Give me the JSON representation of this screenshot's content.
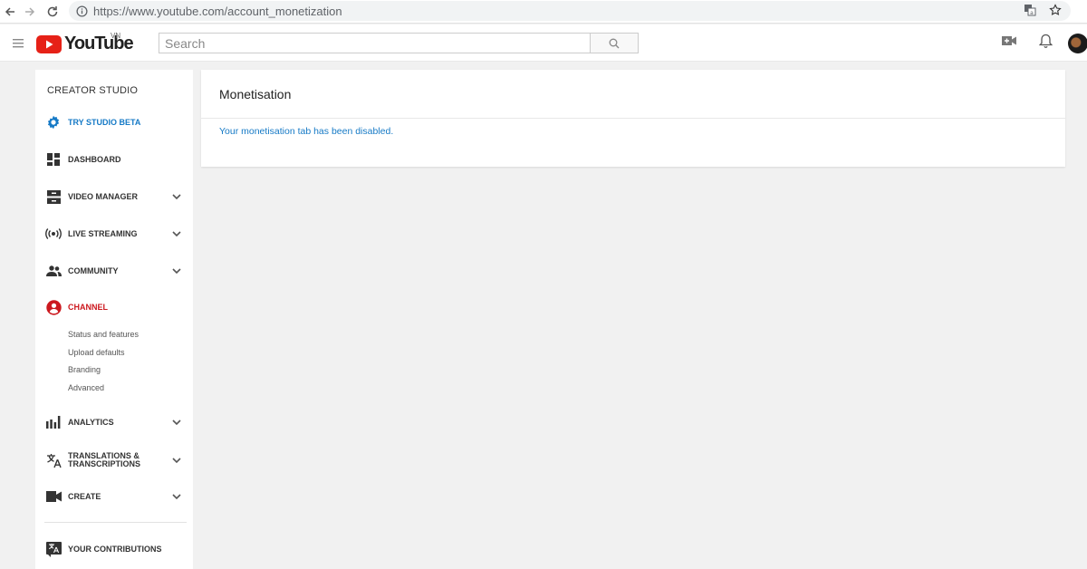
{
  "browser": {
    "url": "https://www.youtube.com/account_monetization"
  },
  "header": {
    "logo_word": "YouTube",
    "country_code": "VN",
    "search_placeholder": "Search"
  },
  "sidebar": {
    "title": "CREATOR STUDIO",
    "items": [
      {
        "label": "TRY STUDIO BETA",
        "icon": "gear-icon"
      },
      {
        "label": "DASHBOARD",
        "icon": "dashboard-icon"
      },
      {
        "label": "VIDEO MANAGER",
        "icon": "video-manager-icon"
      },
      {
        "label": "LIVE STREAMING",
        "icon": "live-streaming-icon"
      },
      {
        "label": "COMMUNITY",
        "icon": "community-icon"
      },
      {
        "label": "CHANNEL",
        "icon": "channel-icon"
      },
      {
        "label": "ANALYTICS",
        "icon": "analytics-icon"
      },
      {
        "label": "TRANSLATIONS & TRANSCRIPTIONS",
        "icon": "translate-icon"
      },
      {
        "label": "CREATE",
        "icon": "create-icon"
      },
      {
        "label": "YOUR CONTRIBUTIONS",
        "icon": "contributions-icon"
      }
    ],
    "channel_sub": [
      "Status and features",
      "Upload defaults",
      "Branding",
      "Advanced"
    ]
  },
  "main": {
    "title": "Monetisation",
    "message": "Your monetisation tab has been disabled."
  },
  "colors": {
    "accent_blue": "#167ac6",
    "accent_red": "#cc181e",
    "background": "#f1f1f1"
  }
}
